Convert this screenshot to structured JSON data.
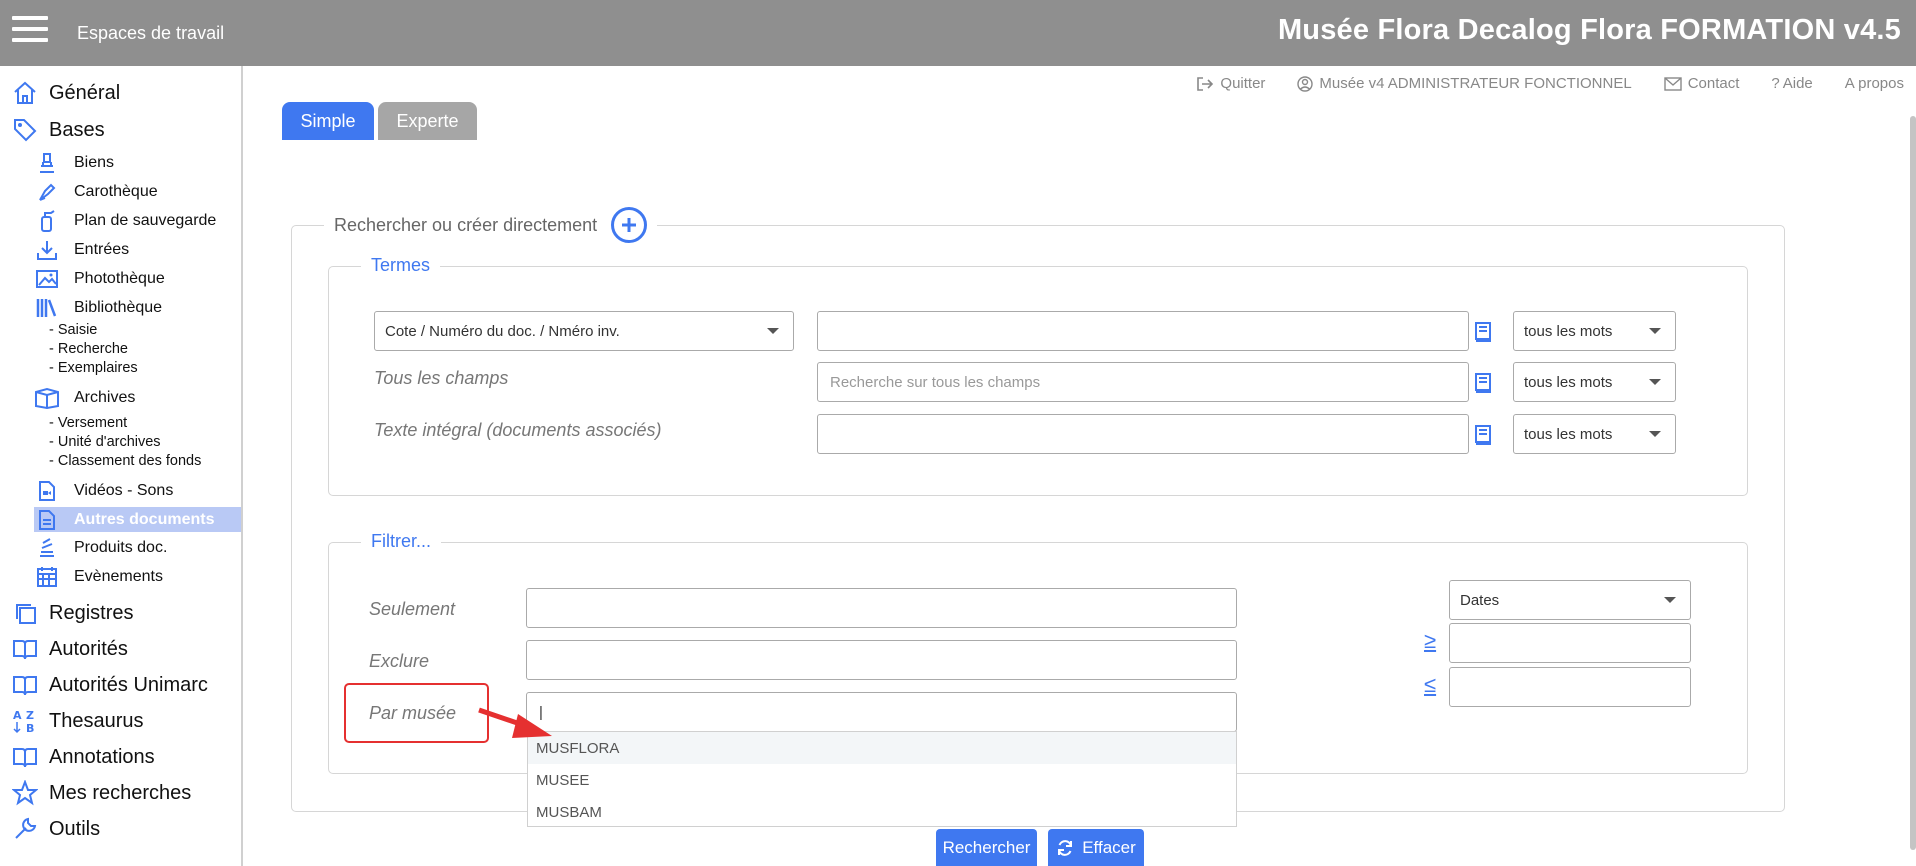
{
  "header": {
    "workspaces": "Espaces de travail",
    "app_title": "Musée Flora Decalog Flora FORMATION v4.5"
  },
  "toplinks": {
    "quit": "Quitter",
    "user": "Musée v4 ADMINISTRATEUR FONCTIONNEL",
    "contact": "Contact",
    "help": "Aide",
    "about": "A propos"
  },
  "sidebar": {
    "general": "Général",
    "bases": "Bases",
    "biens": "Biens",
    "carotheque": "Carothèque",
    "plan": "Plan de sauvegarde",
    "entrees": "Entrées",
    "phototheque": "Photothèque",
    "bibliotheque": "Bibliothèque",
    "saisie": "- Saisie",
    "recherche": "- Recherche",
    "exemplaires": "- Exemplaires",
    "archives": "Archives",
    "versement": "- Versement",
    "unite": "- Unité d'archives",
    "classement": "- Classement des fonds",
    "videos": "Vidéos - Sons",
    "autres": "Autres documents",
    "produits": "Produits doc.",
    "evenements": "Evènements",
    "registres": "Registres",
    "autorites": "Autorités",
    "autorites_unimarc": "Autorités Unimarc",
    "thesaurus": "Thesaurus",
    "annotations": "Annotations",
    "mes_recherches": "Mes recherches",
    "outils": "Outils"
  },
  "tabs": {
    "simple": "Simple",
    "experte": "Experte"
  },
  "search": {
    "legend": "Rechercher ou créer directement",
    "termes_legend": "Termes",
    "field_select": "Cote / Numéro du doc. / Nméro inv.",
    "all_fields_label": "Tous les champs",
    "all_fields_placeholder": "Recherche sur tous les champs",
    "fulltext_label": "Texte intégral (documents associés)",
    "mode": "tous les mots"
  },
  "filter": {
    "legend": "Filtrer...",
    "seulement": "Seulement",
    "exclure": "Exclure",
    "par_musee": "Par musée",
    "par_musee_value": "|",
    "dates": "Dates",
    "ge": "≥",
    "le": "≤",
    "options": [
      "MUSFLORA",
      "MUSEE",
      "MUSBAM"
    ]
  },
  "buttons": {
    "rechercher": "Rechercher",
    "effacer": "Effacer"
  },
  "colors": {
    "accent": "#3f78f0",
    "header": "#8f8f8f",
    "highlight": "#e53030"
  }
}
